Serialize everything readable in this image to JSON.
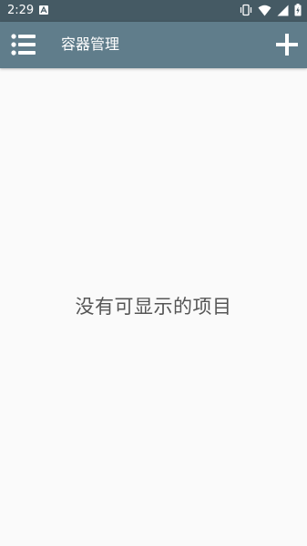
{
  "status_bar": {
    "time": "2:29",
    "notification_icon": "a-letter-notification-icon",
    "icons": [
      "vibrate-icon",
      "wifi-icon",
      "signal-icon",
      "battery-charging-icon"
    ]
  },
  "app_bar": {
    "title": "容器管理",
    "menu_icon": "list-menu-icon",
    "add_icon": "plus-icon"
  },
  "main": {
    "empty_text": "没有可显示的项目"
  },
  "colors": {
    "status_bar": "#455a64",
    "app_bar": "#607d8b",
    "background": "#fafafa",
    "empty_text": "#555555"
  }
}
